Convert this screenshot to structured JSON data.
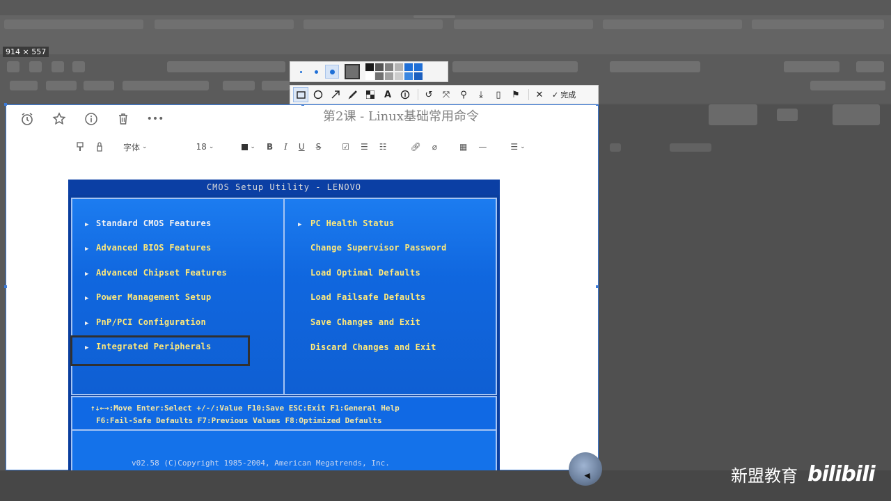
{
  "selection": {
    "size_readout": "914 × 557"
  },
  "doc": {
    "title": "第2课 - Linux基础常用命令",
    "font_label": "字体",
    "font_size": "18",
    "icons": [
      "alarm-clock-icon",
      "star-icon",
      "info-icon",
      "trash-icon",
      "more-icon"
    ]
  },
  "bios": {
    "title": "CMOS Setup Utility - LENOVO",
    "left_items": [
      "Standard CMOS Features",
      "Advanced BIOS Features",
      "Advanced Chipset Features",
      "Power Management Setup",
      "PnP/PCI Configuration",
      "Integrated Peripherals"
    ],
    "right_items": [
      "PC Health Status",
      "Change Supervisor Password",
      "Load Optimal Defaults",
      "Load Failsafe Defaults",
      "Save Changes and Exit",
      "Discard Changes and Exit"
    ],
    "help_line_1": "↑↓←→:Move   Enter:Select   +/-/:Value   F10:Save   ESC:Exit   F1:General Help",
    "help_line_2": "F6:Fail-Safe Defaults    F7:Previous Values    F8:Optimized Defaults",
    "footer": "v02.58 (C)Copyright 1985-2004, American Megatrends, Inc."
  },
  "toolbar": {
    "done_label": "完成",
    "colors": [
      "#1a1a1a",
      "#555555",
      "#808080",
      "#b3b3b3",
      "#1f6fd6",
      "#1f6fd6",
      "#ffffff",
      "#707070",
      "#a0a0a0",
      "#cccccc",
      "#3a86e0",
      "#1b5fbf"
    ]
  },
  "watermark": {
    "text": "新盟教育",
    "brand": "bilibili"
  }
}
